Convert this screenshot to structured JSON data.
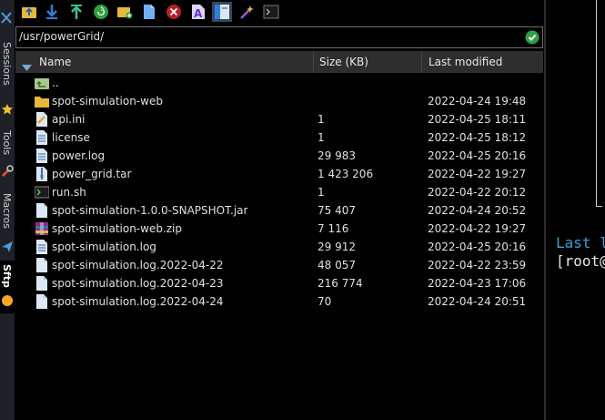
{
  "sidebar": {
    "tabs": [
      {
        "label": "Sessions",
        "icon": "star-icon"
      },
      {
        "label": "Tools",
        "icon": "tools-icon"
      },
      {
        "label": "Macros",
        "icon": "macro-send-icon"
      },
      {
        "label": "Sftp",
        "icon": "sftp-icon"
      }
    ]
  },
  "toolbar": {
    "buttons": [
      {
        "name": "parent-folder-button",
        "icon": "folder-up-icon"
      },
      {
        "name": "download-button",
        "icon": "download-arrow-icon"
      },
      {
        "name": "upload-button",
        "icon": "upload-arrow-icon"
      },
      {
        "name": "refresh-button",
        "icon": "refresh-icon"
      },
      {
        "name": "new-folder-button",
        "icon": "new-folder-icon"
      },
      {
        "name": "new-file-button",
        "icon": "new-file-icon"
      },
      {
        "name": "delete-button",
        "icon": "delete-icon"
      },
      {
        "name": "rename-button",
        "icon": "rename-icon"
      },
      {
        "name": "follow-terminal-button",
        "icon": "follow-terminal-icon"
      },
      {
        "name": "settings-wand-button",
        "icon": "magic-wand-icon"
      },
      {
        "name": "open-terminal-button",
        "icon": "terminal-icon"
      }
    ]
  },
  "path": {
    "value": "/usr/powerGrid/",
    "status_icon": "check-icon"
  },
  "columns": {
    "name": "Name",
    "size": "Size (KB)",
    "modified": "Last modified"
  },
  "files": [
    {
      "name": "..",
      "size": "",
      "modified": "",
      "type": "parent"
    },
    {
      "name": "spot-simulation-web",
      "size": "",
      "modified": "2022-04-24 19:48",
      "type": "folder"
    },
    {
      "name": "api.ini",
      "size": "1",
      "modified": "2022-04-25 18:11",
      "type": "ini"
    },
    {
      "name": "license",
      "size": "1",
      "modified": "2022-04-25 18:12",
      "type": "text"
    },
    {
      "name": "power.log",
      "size": "29 983",
      "modified": "2022-04-25 20:16",
      "type": "text"
    },
    {
      "name": "power_grid.tar",
      "size": "1 423 206",
      "modified": "2022-04-22 19:27",
      "type": "archive"
    },
    {
      "name": "run.sh",
      "size": "1",
      "modified": "2022-04-22 20:12",
      "type": "shell"
    },
    {
      "name": "spot-simulation-1.0.0-SNAPSHOT.jar",
      "size": "75 407",
      "modified": "2022-04-24 20:52",
      "type": "file"
    },
    {
      "name": "spot-simulation-web.zip",
      "size": "7 116",
      "modified": "2022-04-22 19:27",
      "type": "zip"
    },
    {
      "name": "spot-simulation.log",
      "size": "29 912",
      "modified": "2022-04-25 20:16",
      "type": "text"
    },
    {
      "name": "spot-simulation.log.2022-04-22",
      "size": "48 057",
      "modified": "2022-04-22 23:59",
      "type": "file"
    },
    {
      "name": "spot-simulation.log.2022-04-23",
      "size": "216 774",
      "modified": "2022-04-23 17:06",
      "type": "file"
    },
    {
      "name": "spot-simulation.log.2022-04-24",
      "size": "70",
      "modified": "2022-04-24 20:51",
      "type": "file"
    }
  ],
  "terminal": {
    "line1": "Last l",
    "line2": "[root@"
  },
  "colors": {
    "accent": "#3c9fd8",
    "status_ok": "#2ea043",
    "folder": "#e8b83a"
  }
}
